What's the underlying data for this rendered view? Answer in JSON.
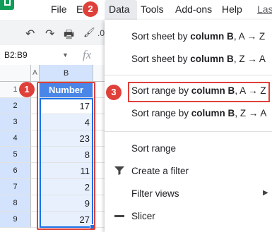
{
  "menu": {
    "file": "File",
    "edit_partial": "Ed",
    "data": "Data",
    "tools": "Tools",
    "addons": "Add-ons",
    "help": "Help",
    "last": "Las"
  },
  "toolbar": {
    "undo": "↶",
    "redo": "↷",
    "print": "🖶",
    "paint": "🖌",
    "partial": ".0"
  },
  "formula_bar": {
    "name_box": "B2:B9",
    "fx": "fx"
  },
  "grid": {
    "col_a": "A",
    "col_b": "B",
    "rows": [
      {
        "num": "1",
        "value": "Number"
      },
      {
        "num": "2",
        "value": "17"
      },
      {
        "num": "3",
        "value": "4"
      },
      {
        "num": "4",
        "value": "23"
      },
      {
        "num": "5",
        "value": "8"
      },
      {
        "num": "6",
        "value": "11"
      },
      {
        "num": "7",
        "value": "2"
      },
      {
        "num": "8",
        "value": "9"
      },
      {
        "num": "9",
        "value": "27"
      }
    ]
  },
  "dropdown": {
    "sort_sheet_az_prefix": "Sort sheet by ",
    "sort_sheet_az_bold": "column B",
    "sort_sheet_az_suffix": ", A → Z",
    "sort_sheet_za_prefix": "Sort sheet by ",
    "sort_sheet_za_bold": "column B",
    "sort_sheet_za_suffix": ", Z → A",
    "sort_range_az_prefix": "Sort range by ",
    "sort_range_az_bold": "column B",
    "sort_range_az_suffix": ", A → Z",
    "sort_range_za_prefix": "Sort range by ",
    "sort_range_za_bold": "column B",
    "sort_range_za_suffix": ", Z → A",
    "sort_range": "Sort range",
    "create_filter": "Create a filter",
    "filter_views": "Filter views",
    "slicer": "Slicer"
  },
  "badges": {
    "one": "1",
    "two": "2",
    "three": "3"
  },
  "colors": {
    "accent_red": "#e0403a",
    "header_blue": "#4a86e8",
    "selection_blue": "#1a73e8",
    "sheets_green": "#0f9d58"
  }
}
